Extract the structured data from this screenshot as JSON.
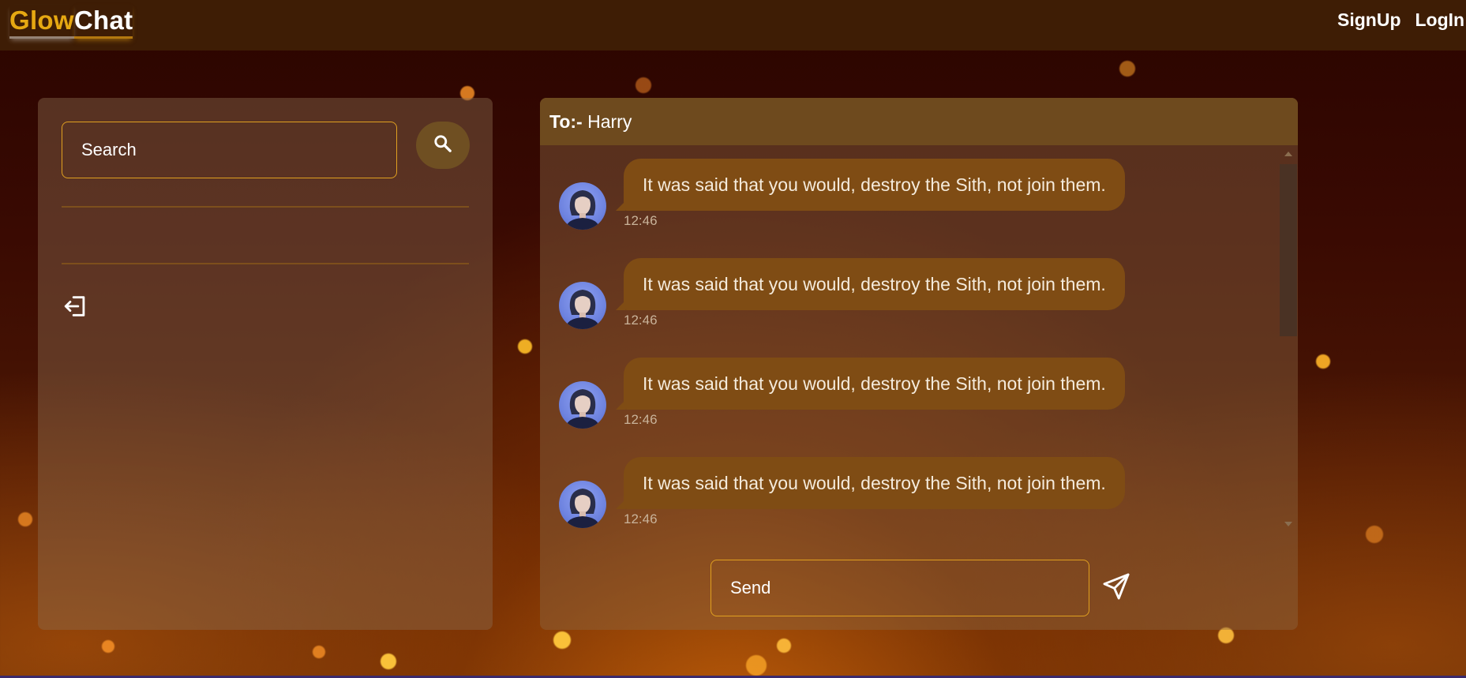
{
  "navbar": {
    "logo_part1": "Glow",
    "logo_part2": "Chat",
    "signup_label": "SignUp",
    "login_label": "LogIn"
  },
  "sidebar": {
    "search_placeholder": "Search",
    "search_icon": "search-icon",
    "logout_icon": "logout-icon"
  },
  "chat": {
    "to_label": "To:-",
    "recipient": "Harry",
    "messages": [
      {
        "text": "It was said that you would, destroy the Sith, not join them.",
        "time": "12:46"
      },
      {
        "text": "It was said that you would, destroy the Sith, not join them.",
        "time": "12:46"
      },
      {
        "text": "It was said that you would, destroy the Sith, not join them.",
        "time": "12:46"
      },
      {
        "text": "It was said that you would, destroy the Sith, not join them.",
        "time": "12:46"
      }
    ],
    "send_placeholder": "Send",
    "send_icon": "send-icon"
  },
  "colors": {
    "accent": "#e6a812",
    "bubble": "#7f4c14",
    "navbar": "#3e1d05",
    "input_border": "#e0a020"
  }
}
